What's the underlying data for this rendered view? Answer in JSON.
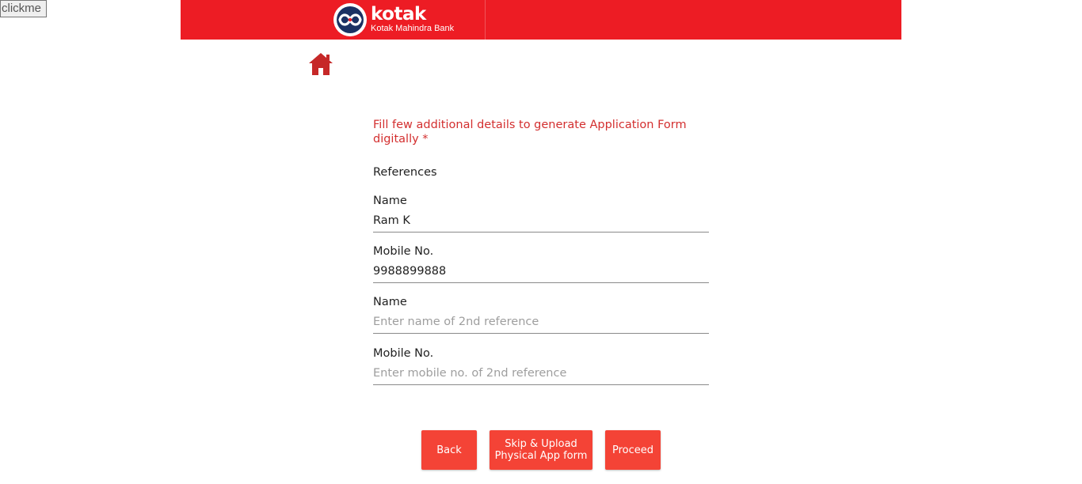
{
  "debug": {
    "clickme_label": "clickme"
  },
  "header": {
    "brand": "kotak",
    "brand_sub": "Kotak Mahindra Bank",
    "brand_color": "#ed1c24"
  },
  "nav": {
    "home_icon": "home-icon",
    "home_icon_color": "#c62828"
  },
  "form": {
    "intro": "Fill few additional details to generate Application Form digitally *",
    "section_title": "References",
    "fields": [
      {
        "label": "Name",
        "value": "Ram K",
        "placeholder": ""
      },
      {
        "label": "Mobile No.",
        "value": "9988899888",
        "placeholder": ""
      },
      {
        "label": "Name",
        "value": "",
        "placeholder": "Enter name of 2nd reference"
      },
      {
        "label": "Mobile No.",
        "value": "",
        "placeholder": "Enter mobile no. of 2nd reference"
      }
    ]
  },
  "actions": {
    "back_label": "Back",
    "skip_label": "Skip & Upload\nPhysical App form",
    "proceed_label": "Proceed",
    "button_color": "#f44336"
  }
}
